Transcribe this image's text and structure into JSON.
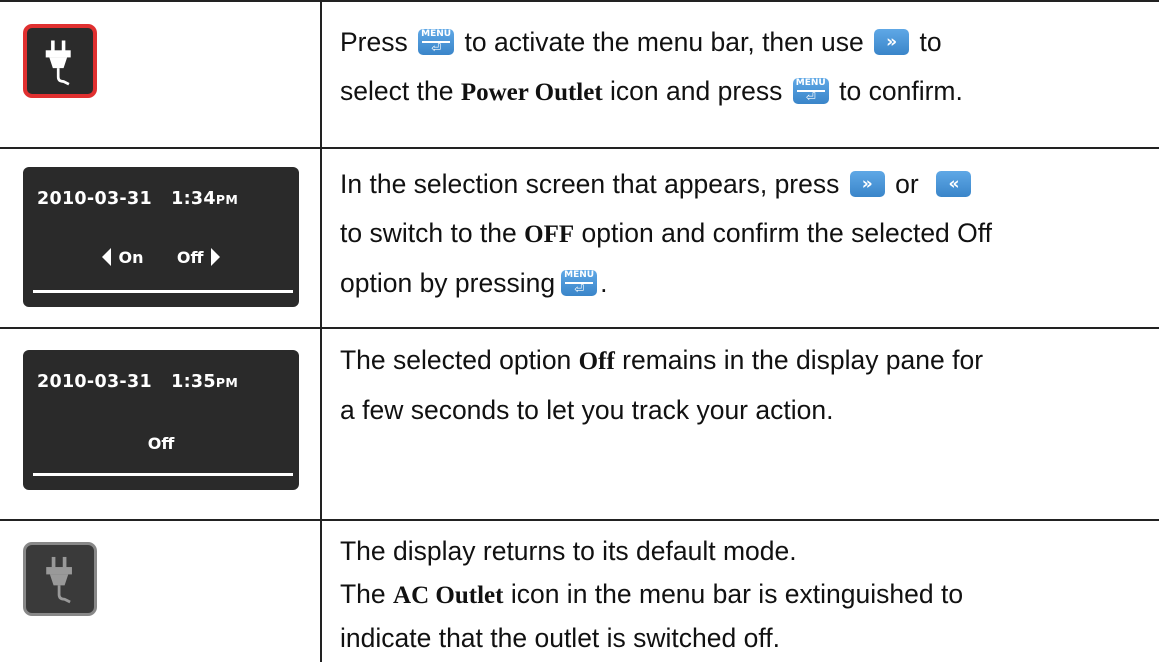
{
  "keys": {
    "menu_label": "MENU",
    "menu_return": "⏎",
    "right_arrow": "»",
    "left_arrow": "«"
  },
  "row1": {
    "icon": "power-outlet-icon-active",
    "l1_a": "Press",
    "l1_b": "to activate the menu bar, then use",
    "l1_c": "to",
    "l2_a": "select the",
    "l2_bold": "Power Outlet",
    "l2_b": "icon and press",
    "l2_c": "to confirm."
  },
  "row2": {
    "screen": {
      "date": "2010-03-31",
      "time": "1:34",
      "ampm": "PM",
      "opt_on": "On",
      "opt_off": "Off"
    },
    "l1_a": "In the selection screen that appears, press",
    "l1_b": "or",
    "l2_a": "to switch to the",
    "l2_bold": "OFF",
    "l2_b": "option and confirm the selected Off",
    "l3_a": "option by pressing",
    "l3_b": "."
  },
  "row3": {
    "screen": {
      "date": "2010-03-31",
      "time": "1:35",
      "ampm": "PM",
      "value": "Off"
    },
    "l1_a": "The selected option",
    "l1_bold": "Off",
    "l1_b": "remains in the display pane for",
    "l2": "a few seconds to let you track your action."
  },
  "row4": {
    "icon": "power-outlet-icon-off",
    "l1": "The display returns to its default mode.",
    "l2_a": "The",
    "l2_bold": "AC Outlet",
    "l2_b": "icon in the menu bar is extinguished to",
    "l3": "indicate that the outlet is switched off."
  },
  "colors": {
    "accent_red": "#e03030",
    "key_blue": "#4a95d8",
    "screen_bg": "#2a2a2a"
  }
}
